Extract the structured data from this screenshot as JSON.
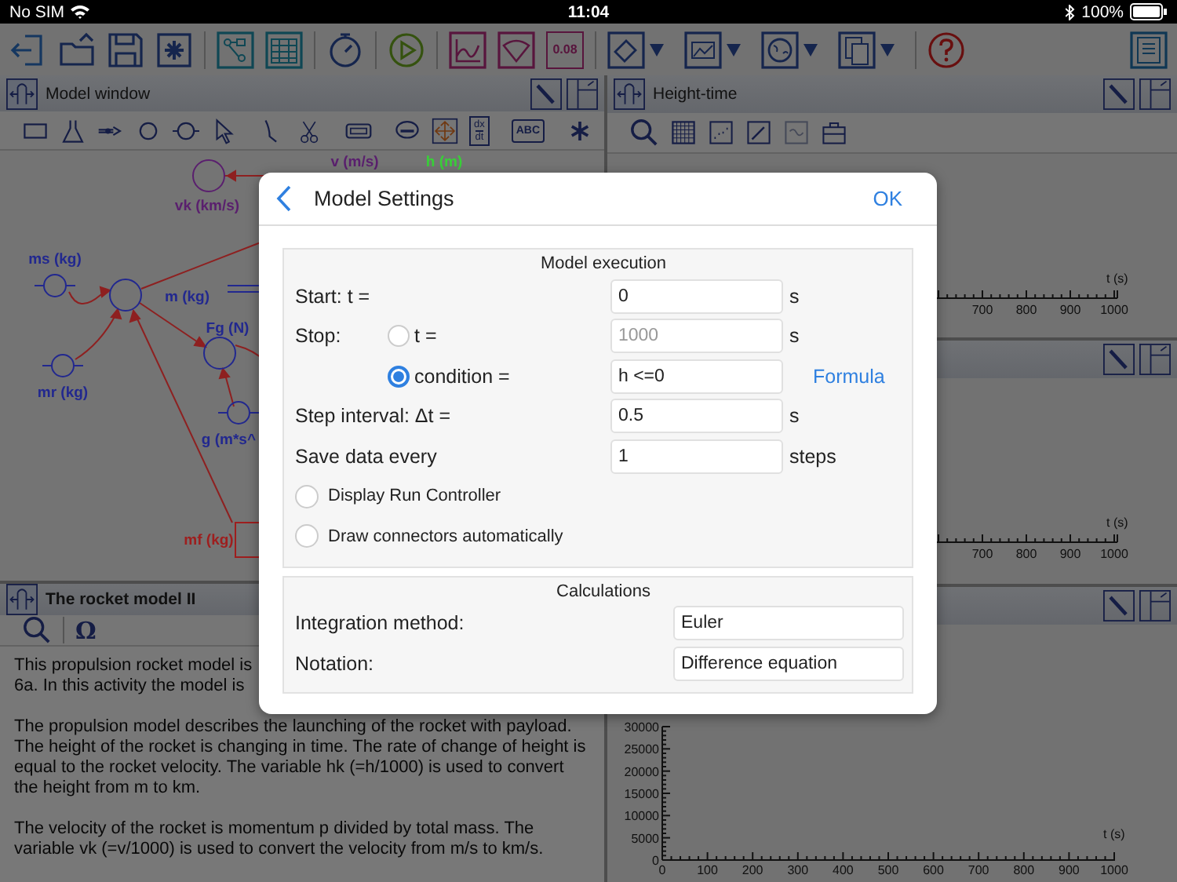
{
  "status_bar": {
    "carrier": "No SIM",
    "time": "11:04",
    "battery": "100%"
  },
  "toolbar": {
    "value_button": "0.08"
  },
  "model_window": {
    "title": "Model window",
    "derivative_tool": {
      "top": "dx",
      "bottom": "dt"
    },
    "text_tool": "ABC",
    "nodes": [
      {
        "label": "vk (km/s)",
        "kind": "variable",
        "color": "#5a1f6e"
      },
      {
        "label": "v (m/s)",
        "kind": "hidden",
        "color": "#5a1f6e"
      },
      {
        "label": "h (m)",
        "kind": "hidden",
        "color": "#38d038"
      },
      {
        "label": "ms (kg)",
        "kind": "constant",
        "color": "#22288f"
      },
      {
        "label": "m (kg)",
        "kind": "variable",
        "color": "#22288f"
      },
      {
        "label": "mr (kg)",
        "kind": "constant",
        "color": "#22288f"
      },
      {
        "label": "Fg (N)",
        "kind": "variable",
        "color": "#22288f"
      },
      {
        "label": "g (m*s^",
        "kind": "constant",
        "color": "#22288f"
      },
      {
        "label": "mf (kg)",
        "kind": "stock",
        "color": "#9e1e1e"
      }
    ]
  },
  "graph_top": {
    "title": "Height-time",
    "x_axis_label": "t (s)",
    "x_tick_labels": [
      "700",
      "800",
      "900",
      "1000"
    ]
  },
  "graph_middle": {
    "x_axis_label": "t (s)",
    "x_tick_labels": [
      "700",
      "800",
      "900",
      "1000"
    ]
  },
  "text_window": {
    "title": "The rocket model II",
    "symbol_tool": "Ω",
    "paragraphs": [
      "This propulsion rocket model is\n6a. In this activity the model is",
      "The propulsion model describes the launching of the rocket with payload. The height of the rocket is changing in time. The rate of change of height is equal to the rocket velocity. The variable hk (=h/1000) is used to convert the height from m to km.",
      "The velocity of the rocket is momentum p divided by total mass.  The variable vk (=v/1000) is used to convert the velocity from m/s to km/s."
    ]
  },
  "graph_bottom": {
    "chart_data": {
      "type": "line",
      "xlabel": "t (s)",
      "xlim": [
        0,
        1000
      ],
      "ylim": [
        0,
        30000
      ],
      "xticks": [
        0,
        100,
        200,
        300,
        400,
        500,
        600,
        700,
        800,
        900,
        1000
      ],
      "yticks": [
        0,
        5000,
        10000,
        15000,
        20000,
        25000,
        30000
      ]
    }
  },
  "dialog": {
    "title": "Model Settings",
    "done": "OK",
    "execution": {
      "heading": "Model execution",
      "start": {
        "label": "Start:  t =",
        "value": "0",
        "unit": "s"
      },
      "stop": {
        "label": "Stop:",
        "options": [
          {
            "label": "t =",
            "value": "1000",
            "unit": "s",
            "selected": false
          },
          {
            "label": "condition =",
            "value": "h <=0",
            "link": "Formula",
            "selected": true
          }
        ]
      },
      "step": {
        "label": "Step interval:  Δt =",
        "value": "0.5",
        "unit": "s"
      },
      "save": {
        "label": "Save data every",
        "value": "1",
        "unit": "steps"
      },
      "options": [
        {
          "label": "Display Run Controller",
          "checked": false
        },
        {
          "label": "Draw connectors automatically",
          "checked": false
        }
      ]
    },
    "calculations": {
      "heading": "Calculations",
      "rows": [
        {
          "label": "Integration method:",
          "value": "Euler"
        },
        {
          "label": "Notation:",
          "value": "Difference equation"
        }
      ]
    }
  }
}
